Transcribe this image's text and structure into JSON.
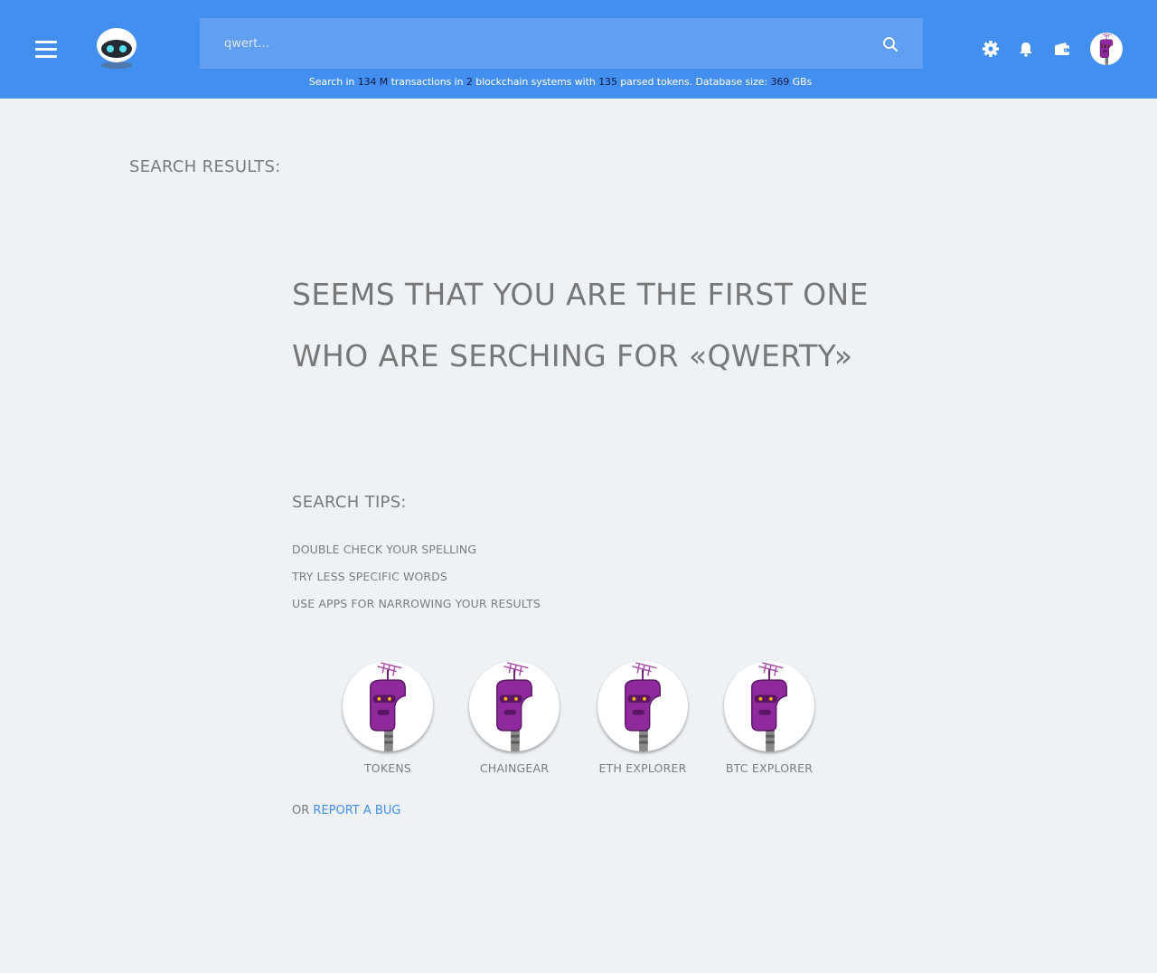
{
  "header": {
    "search": {
      "value": "",
      "placeholder": "qwert..."
    },
    "stats": {
      "prefix": "Search in",
      "transactions": "134 M",
      "transactions_label": "transactions in",
      "blockchains": "2",
      "blockchains_label": "blockchain systems with",
      "tokens": "135",
      "tokens_label": "parsed tokens. Database size:",
      "db_size": "369",
      "db_unit": "GBs"
    },
    "icons": [
      "menu-icon",
      "logo-robot-icon",
      "search-icon",
      "gear-icon",
      "bell-icon",
      "wallet-icon",
      "avatar"
    ]
  },
  "main": {
    "results_title": "SEARCH RESULTS:",
    "message_line1": "SEEMS THAT YOU ARE THE FIRST ONE",
    "message_line2": "WHO ARE SERCHING FOR «QWERTY»",
    "tips_title": "SEARCH TIPS:",
    "tips": [
      "DOUBLE CHECK YOUR SPELLING",
      "TRY LESS SPECIFIC WORDS",
      "USE APPS FOR NARROWING YOUR RESULTS"
    ],
    "apps": [
      {
        "label": "TOKENS"
      },
      {
        "label": "CHAINGEAR"
      },
      {
        "label": "ETH EXPLORER"
      },
      {
        "label": "BTC EXPLORER"
      }
    ],
    "report_prefix": "OR",
    "report_link": "REPORT A BUG"
  },
  "colors": {
    "header_bg": "#438ff0",
    "search_bg": "#619ff2",
    "page_bg": "#eef2f5",
    "link": "#438ff0",
    "robot_purple": "#8e2a9c"
  }
}
